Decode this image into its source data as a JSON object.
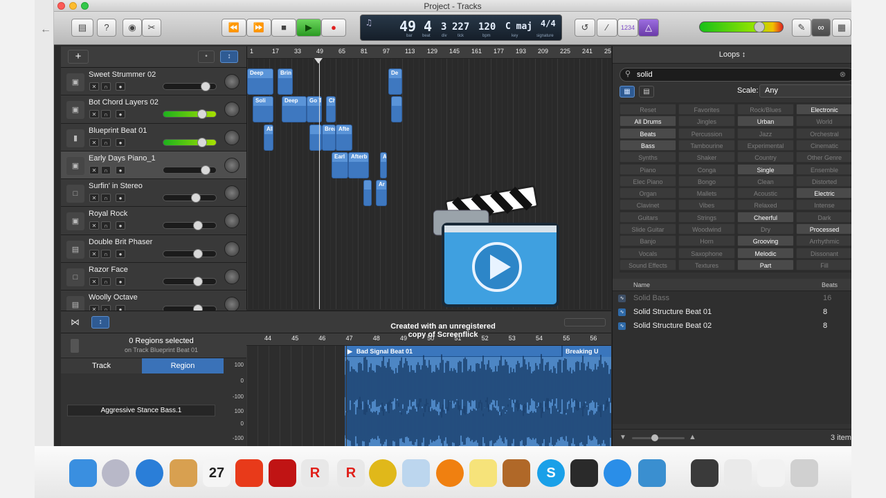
{
  "window": {
    "title": "Project - Tracks"
  },
  "toolbar": {
    "lcd": {
      "bar": "49",
      "beat": "4",
      "div": "3",
      "tick": "227",
      "tempo": "120",
      "key": "C maj",
      "signature": "4/4",
      "bar_label": "bar",
      "beat_label": "beat",
      "div_label": "div",
      "tick_label": "tick",
      "tempo_label": "bpm",
      "key_label": "key",
      "signature_label": "signature"
    },
    "count_in": "1234"
  },
  "tracks": [
    {
      "name": "Sweet Strummer 02",
      "icon": "folder-icon",
      "fader": 0.84,
      "active": false
    },
    {
      "name": "Bot Chord Layers 02",
      "icon": "folder-icon",
      "fader": 0.77,
      "active": true
    },
    {
      "name": "Blueprint Beat 01",
      "icon": "drum-machine-icon",
      "fader": 0.77,
      "active": true
    },
    {
      "name": "Early Days Piano_1",
      "icon": "folder-icon",
      "fader": 0.84,
      "active": false,
      "selected": true
    },
    {
      "name": "Surfin' in Stereo",
      "icon": "document-icon",
      "fader": 0.63,
      "active": false
    },
    {
      "name": "Royal Rock",
      "icon": "folder-icon",
      "fader": 0.67,
      "active": false
    },
    {
      "name": "Double Brit Phaser",
      "icon": "amp-icon",
      "fader": 0.67,
      "active": false
    },
    {
      "name": "Razor Face",
      "icon": "document-icon",
      "fader": 0.67,
      "active": false
    },
    {
      "name": "Woolly Octave",
      "icon": "amp-icon",
      "fader": 0.67,
      "active": false
    }
  ],
  "ruler": [
    "1",
    "17",
    "33",
    "49",
    "65",
    "81",
    "97",
    "113",
    "129",
    "145",
    "161",
    "177",
    "193",
    "209",
    "225",
    "241",
    "25"
  ],
  "regions": [
    {
      "label": "Deep",
      "row": 0,
      "start": 0,
      "end": 38
    },
    {
      "label": "Brin",
      "row": 0,
      "start": 44,
      "end": 66
    },
    {
      "label": "De",
      "row": 0,
      "start": 204,
      "end": 224
    },
    {
      "label": "Soli",
      "row": 1,
      "start": 8,
      "end": 38
    },
    {
      "label": "Deep",
      "row": 1,
      "start": 50,
      "end": 86
    },
    {
      "label": "Go T",
      "row": 1,
      "start": 86,
      "end": 108
    },
    {
      "label": "Ch",
      "row": 1,
      "start": 114,
      "end": 128
    },
    {
      "label": "",
      "row": 1,
      "start": 208,
      "end": 224
    },
    {
      "label": "All",
      "row": 2,
      "start": 24,
      "end": 38
    },
    {
      "label": "",
      "row": 2,
      "start": 90,
      "end": 108
    },
    {
      "label": "Brea",
      "row": 2,
      "start": 108,
      "end": 128
    },
    {
      "label": "Afte",
      "row": 2,
      "start": 128,
      "end": 152
    },
    {
      "label": "Earl",
      "row": 3,
      "start": 122,
      "end": 146
    },
    {
      "label": "Afterb",
      "row": 3,
      "start": 146,
      "end": 176
    },
    {
      "label": "A",
      "row": 3,
      "start": 192,
      "end": 202
    },
    {
      "label": "",
      "row": 4,
      "start": 168,
      "end": 180
    },
    {
      "label": "Ar",
      "row": 4,
      "start": 186,
      "end": 202
    }
  ],
  "watermark": "Created with an unregistered copy of Screenflick",
  "loops": {
    "title": "Loops ↕",
    "search": "solid",
    "scale_label": "Scale:",
    "scale_value": "Any",
    "keywords": [
      [
        [
          "Reset",
          false
        ],
        [
          "Favorites",
          false
        ],
        [
          "Rock/Blues",
          false
        ],
        [
          "Electronic",
          true
        ]
      ],
      [
        [
          "All Drums",
          true
        ],
        [
          "Jingles",
          false
        ],
        [
          "Urban",
          true
        ],
        [
          "World",
          false
        ]
      ],
      [
        [
          "Beats",
          true
        ],
        [
          "Percussion",
          false
        ],
        [
          "Jazz",
          false
        ],
        [
          "Orchestral",
          false
        ]
      ],
      [
        [
          "Bass",
          true
        ],
        [
          "Tambourine",
          false
        ],
        [
          "Experimental",
          false
        ],
        [
          "Cinematic",
          false
        ]
      ],
      [
        [
          "Synths",
          false
        ],
        [
          "Shaker",
          false
        ],
        [
          "Country",
          false
        ],
        [
          "Other Genre",
          false
        ]
      ],
      [
        [
          "Piano",
          false
        ],
        [
          "Conga",
          false
        ],
        [
          "Single",
          true
        ],
        [
          "Ensemble",
          false
        ]
      ],
      [
        [
          "Elec Piano",
          false
        ],
        [
          "Bongo",
          false
        ],
        [
          "Clean",
          false
        ],
        [
          "Distorted",
          false
        ]
      ],
      [
        [
          "Organ",
          false
        ],
        [
          "Mallets",
          false
        ],
        [
          "Acoustic",
          false
        ],
        [
          "Electric",
          true
        ]
      ],
      [
        [
          "Clavinet",
          false
        ],
        [
          "Vibes",
          false
        ],
        [
          "Relaxed",
          false
        ],
        [
          "Intense",
          false
        ]
      ],
      [
        [
          "Guitars",
          false
        ],
        [
          "Strings",
          false
        ],
        [
          "Cheerful",
          true
        ],
        [
          "Dark",
          false
        ]
      ],
      [
        [
          "Slide Guitar",
          false
        ],
        [
          "Woodwind",
          false
        ],
        [
          "Dry",
          false
        ],
        [
          "Processed",
          true
        ]
      ],
      [
        [
          "Banjo",
          false
        ],
        [
          "Horn",
          false
        ],
        [
          "Grooving",
          true
        ],
        [
          "Arrhythmic",
          false
        ]
      ],
      [
        [
          "Vocals",
          false
        ],
        [
          "Saxophone",
          false
        ],
        [
          "Melodic",
          true
        ],
        [
          "Dissonant",
          false
        ]
      ],
      [
        [
          "Sound Effects",
          false
        ],
        [
          "Textures",
          false
        ],
        [
          "Part",
          true
        ],
        [
          "Fill",
          false
        ]
      ]
    ],
    "col_name": "Name",
    "col_beats": "Beats",
    "results": [
      {
        "name": "Solid Bass",
        "beats": "16",
        "dim": true
      },
      {
        "name": "Solid Structure Beat 01",
        "beats": "8",
        "dim": false
      },
      {
        "name": "Solid Structure Beat 02",
        "beats": "8",
        "dim": false
      }
    ],
    "count": "3 item"
  },
  "editor": {
    "regions_selected": "0 Regions selected",
    "on_track": "on Track Blueprint Beat 01",
    "tab_track": "Track",
    "tab_region": "Region",
    "region_name": "Aggressive Stance Bass.1",
    "ruler": [
      "44",
      "45",
      "46",
      "47",
      "48",
      "49",
      "50",
      "51",
      "52",
      "53",
      "54",
      "55",
      "56"
    ],
    "db": [
      "100",
      "0",
      "-100",
      "100",
      "0",
      "-100"
    ],
    "region_label": "Bad Signal Beat 01",
    "region2_label": "Breaking U"
  },
  "dock": [
    {
      "name": "finder-icon",
      "color": "#3a8fe0"
    },
    {
      "name": "rocket-icon",
      "color": "#b8b8c8"
    },
    {
      "name": "safari-icon",
      "color": "#2a7ed8"
    },
    {
      "name": "contacts-icon",
      "color": "#d8a050"
    },
    {
      "name": "calendar-icon",
      "color": "#f5f5f5"
    },
    {
      "name": "photo-icon",
      "color": "#e83a1a"
    },
    {
      "name": "photo-booth-icon",
      "color": "#c01414"
    },
    {
      "name": "roblox-icon",
      "color": "#e8e8e8"
    },
    {
      "name": "roblox-studio-icon",
      "color": "#e8e8e8"
    },
    {
      "name": "chrome-icon",
      "color": "#e0b81a"
    },
    {
      "name": "preview-icon",
      "color": "#bcd6ee"
    },
    {
      "name": "ibooks-icon",
      "color": "#f08010"
    },
    {
      "name": "stickies-icon",
      "color": "#f6e37a"
    },
    {
      "name": "garageband-icon",
      "color": "#b06828"
    },
    {
      "name": "skype-icon",
      "color": "#1aa0e8"
    },
    {
      "name": "downloader-icon",
      "color": "#2a2a2a"
    },
    {
      "name": "itunes-icon",
      "color": "#2a8ee8"
    },
    {
      "name": "screenflick-icon",
      "color": "#3a8fd0"
    },
    {
      "name": "music-folder-icon",
      "color": "#3a3a3a"
    },
    {
      "name": "document-icon",
      "color": "#eaeaea"
    },
    {
      "name": "downloads-icon",
      "color": "#f2f2f2"
    },
    {
      "name": "trash-icon",
      "color": "#d0d0d0"
    }
  ],
  "dock_calendar_day": "27",
  "dock_roblox": "R",
  "dock_skype": "S"
}
